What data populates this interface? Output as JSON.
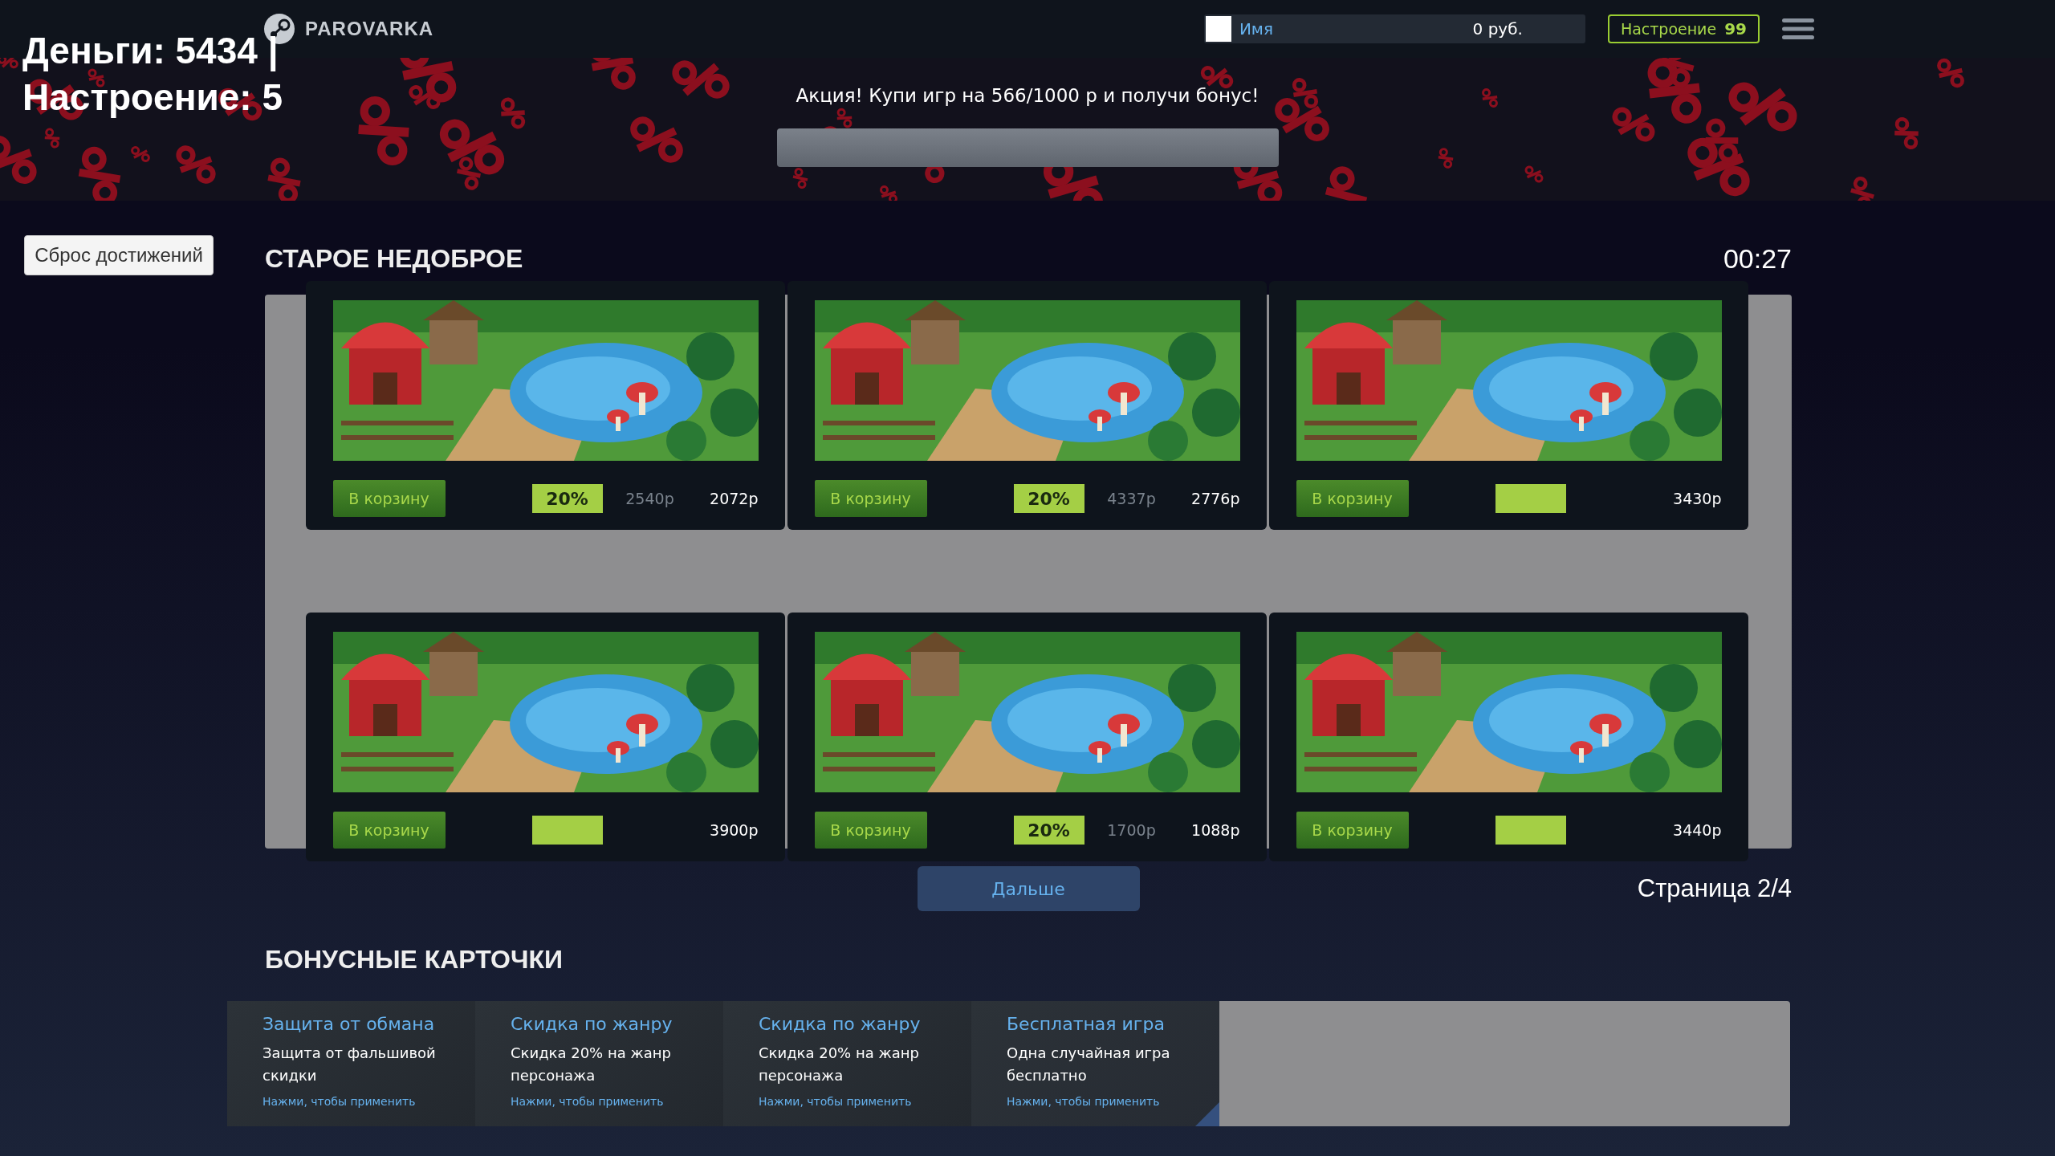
{
  "overlay": {
    "money": "Деньги: 5434 |",
    "mood": "Настроение: 5"
  },
  "header": {
    "logo": "PAROVARKA",
    "user": {
      "name": "Имя",
      "balance": "0 руб."
    },
    "mood_badge": {
      "label": "Настроение",
      "value": "99"
    }
  },
  "promo": {
    "text": "Акция! Купи игр на 566/1000 р и получи бонус!",
    "level": 0
  },
  "reset_button": "Сброс достижений",
  "store": {
    "title": "СТАРОЕ НЕДОБРОЕ",
    "timer": "00:27",
    "games": [
      {
        "button": "В корзину",
        "discount": "20%",
        "old_price": "2540р",
        "price": "2072р"
      },
      {
        "button": "В корзину",
        "discount": "20%",
        "old_price": "4337р",
        "price": "2776р"
      },
      {
        "button": "В корзину",
        "price": "3430р"
      },
      {
        "button": "В корзину",
        "price": "3900р"
      },
      {
        "button": "В корзину",
        "discount": "20%",
        "old_price": "1700р",
        "price": "1088р"
      },
      {
        "button": "В корзину",
        "price": "3440р"
      }
    ],
    "next_button": "Дальше",
    "page": "Страница 2/4"
  },
  "bonus": {
    "title": "БОНУСНЫЕ КАРТОЧКИ",
    "cards": [
      {
        "title": "Защита от обмана",
        "description": "Защита от фальшивой скидки",
        "hint": "Нажми, чтобы применить",
        "selected": false
      },
      {
        "title": "Скидка по жанру",
        "description": "Скидка 20% на жанр персонажа",
        "hint": "Нажми, чтобы применить",
        "selected": false
      },
      {
        "title": "Скидка по жанру",
        "description": "Скидка 20% на жанр персонажа",
        "hint": "Нажми, чтобы применить",
        "selected": false
      },
      {
        "title": "Бесплатная игра",
        "description": "Одна случайная игра бесплатно",
        "hint": "Нажми, чтобы применить",
        "selected": true
      }
    ]
  }
}
